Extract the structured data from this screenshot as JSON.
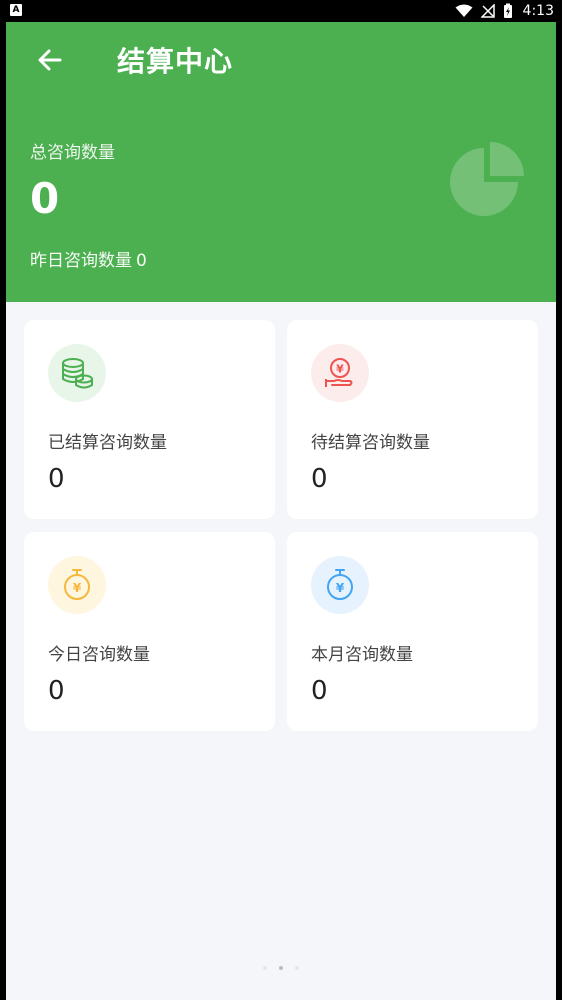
{
  "status_bar": {
    "left_icon": "A",
    "time": "4:13",
    "icons": [
      "wifi-icon",
      "signal-off-icon",
      "battery-charging-icon"
    ]
  },
  "header": {
    "title": "结算中心",
    "back_icon": "arrow-left-icon",
    "total_label": "总咨询数量",
    "total_value": "0",
    "yesterday_label": "昨日咨询数量",
    "yesterday_value": "0",
    "decor_icon": "pie-chart-icon"
  },
  "cards": [
    {
      "label": "已结算咨询数量",
      "value": "0",
      "icon": "coin-stack-icon",
      "color": "#4caf50",
      "bg": "#e8f5e9"
    },
    {
      "label": "待结算咨询数量",
      "value": "0",
      "icon": "yen-hand-icon",
      "color": "#ef5350",
      "bg": "#fdecec"
    },
    {
      "label": "今日咨询数量",
      "value": "0",
      "icon": "yen-stopwatch-icon",
      "color": "#f5b83d",
      "bg": "#fff6e0"
    },
    {
      "label": "本月咨询数量",
      "value": "0",
      "icon": "yen-stopwatch-icon",
      "color": "#42a5f5",
      "bg": "#e6f2fd"
    }
  ],
  "colors": {
    "header_green": "#4caf50",
    "page_bg": "#f4f6fa"
  },
  "pager": {
    "count": 3,
    "active": 1
  }
}
